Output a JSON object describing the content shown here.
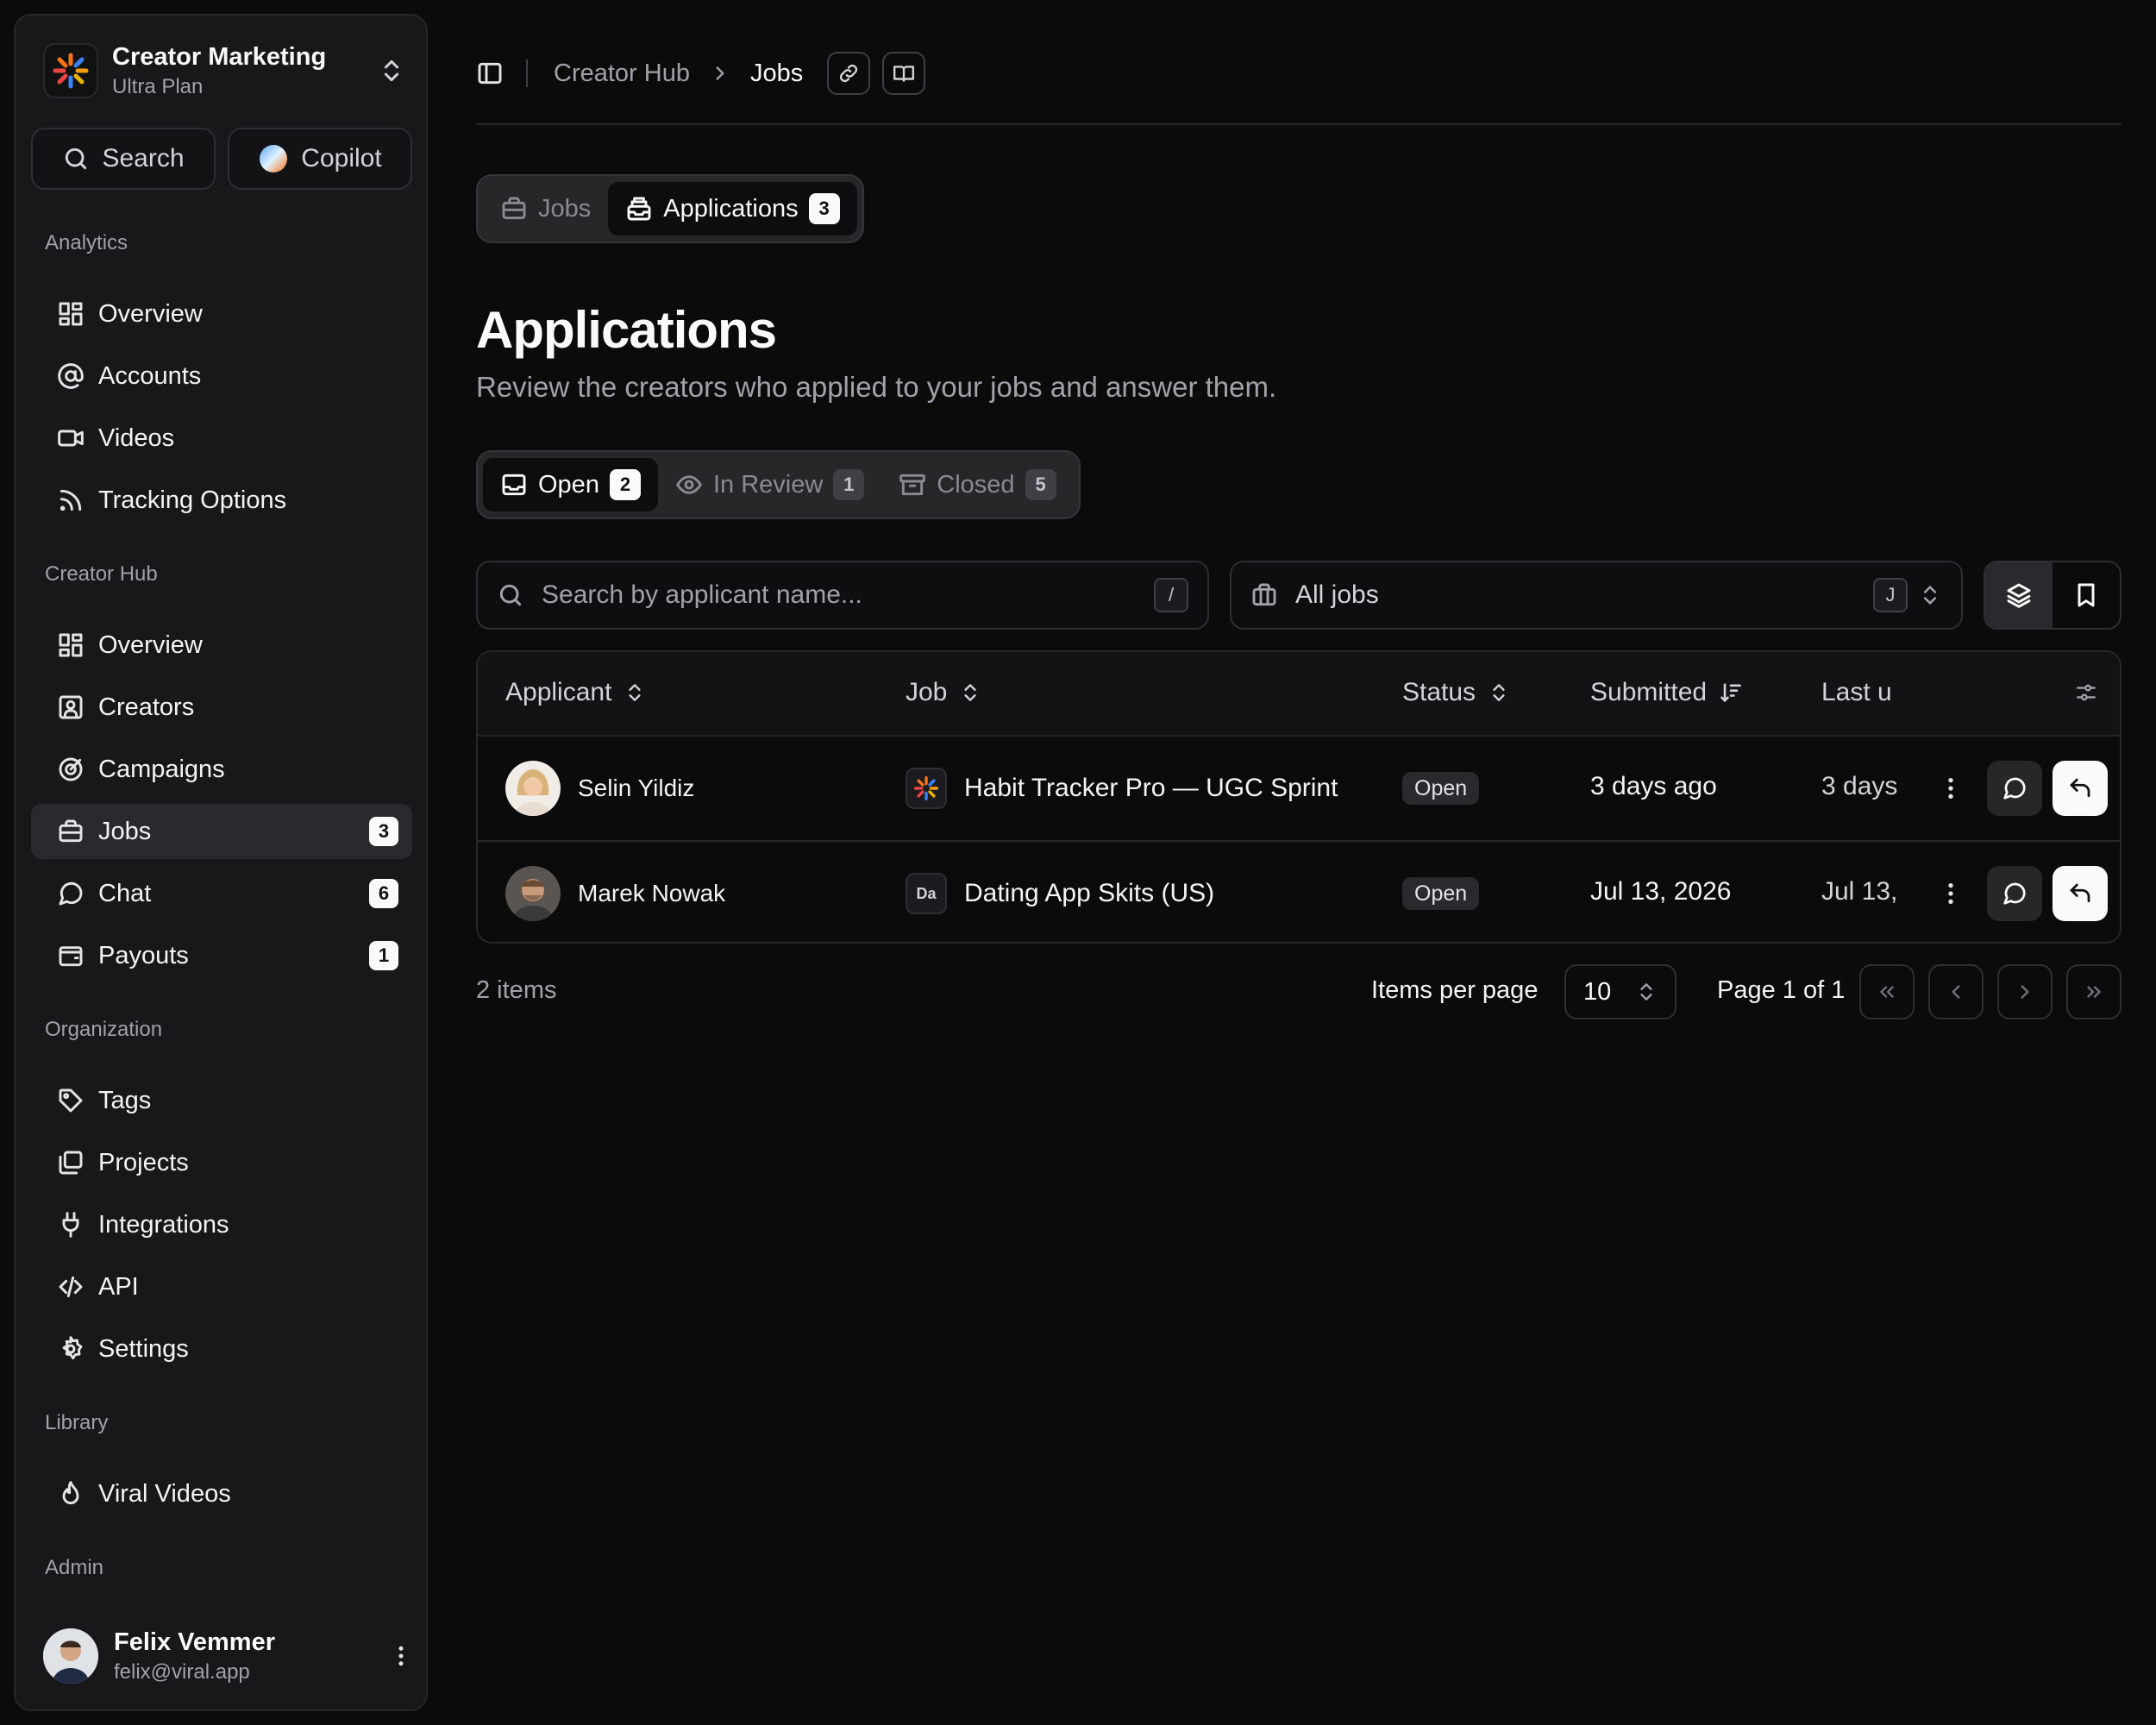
{
  "workspace": {
    "name": "Creator Marketing",
    "plan": "Ultra Plan"
  },
  "sidebar_buttons": {
    "search": "Search",
    "copilot": "Copilot"
  },
  "sections": {
    "analytics": {
      "label": "Analytics",
      "items": [
        {
          "label": "Overview",
          "icon": "grid-icon"
        },
        {
          "label": "Accounts",
          "icon": "at-icon"
        },
        {
          "label": "Videos",
          "icon": "video-icon"
        },
        {
          "label": "Tracking Options",
          "icon": "rss-icon"
        }
      ]
    },
    "creator_hub": {
      "label": "Creator Hub",
      "items": [
        {
          "label": "Overview",
          "icon": "grid-icon"
        },
        {
          "label": "Creators",
          "icon": "contact-icon"
        },
        {
          "label": "Campaigns",
          "icon": "target-icon"
        },
        {
          "label": "Jobs",
          "icon": "briefcase-icon",
          "badge": "3",
          "active": true
        },
        {
          "label": "Chat",
          "icon": "chat-icon",
          "badge": "6"
        },
        {
          "label": "Payouts",
          "icon": "wallet-icon",
          "badge": "1"
        }
      ]
    },
    "organization": {
      "label": "Organization",
      "items": [
        {
          "label": "Tags",
          "icon": "tag-icon"
        },
        {
          "label": "Projects",
          "icon": "folders-icon"
        },
        {
          "label": "Integrations",
          "icon": "plug-icon"
        },
        {
          "label": "API",
          "icon": "code-icon"
        },
        {
          "label": "Settings",
          "icon": "gear-icon"
        }
      ]
    },
    "library": {
      "label": "Library",
      "items": [
        {
          "label": "Viral Videos",
          "icon": "flame-icon"
        }
      ]
    },
    "admin": {
      "label": "Admin"
    }
  },
  "user": {
    "name": "Felix Vemmer",
    "email": "felix@viral.app"
  },
  "breadcrumb": {
    "parent": "Creator Hub",
    "current": "Jobs"
  },
  "top_tabs": [
    {
      "label": "Jobs"
    },
    {
      "label": "Applications",
      "badge": "3",
      "active": true
    }
  ],
  "page": {
    "title": "Applications",
    "subtitle": "Review the creators who applied to your jobs and answer them."
  },
  "status_tabs": [
    {
      "label": "Open",
      "badge": "2",
      "active": true
    },
    {
      "label": "In Review",
      "badge": "1"
    },
    {
      "label": "Closed",
      "badge": "5"
    }
  ],
  "search": {
    "placeholder": "Search by applicant name...",
    "shortcut": "/"
  },
  "job_filter": {
    "value": "All jobs",
    "shortcut": "J"
  },
  "table": {
    "headers": {
      "applicant": "Applicant",
      "job": "Job",
      "status": "Status",
      "submitted": "Submitted",
      "last_updated": "Last u"
    },
    "rows": [
      {
        "applicant": "Selin Yildiz",
        "job": "Habit Tracker Pro — UGC Sprint",
        "job_logo": "sparkle",
        "status": "Open",
        "submitted": "3 days ago",
        "last_updated": "3 days"
      },
      {
        "applicant": "Marek Nowak",
        "job": "Dating App Skits (US)",
        "job_logo": "Da",
        "status": "Open",
        "submitted": "Jul 13, 2026",
        "last_updated": "Jul 13,"
      }
    ]
  },
  "footer": {
    "items_count": "2 items",
    "per_page_label": "Items per page",
    "per_page_value": "10",
    "page_info": "Page 1 of 1"
  },
  "colors": {
    "background": "#0b0b0c",
    "sidebar": "#18181b",
    "accent_light": "#fafafa"
  }
}
